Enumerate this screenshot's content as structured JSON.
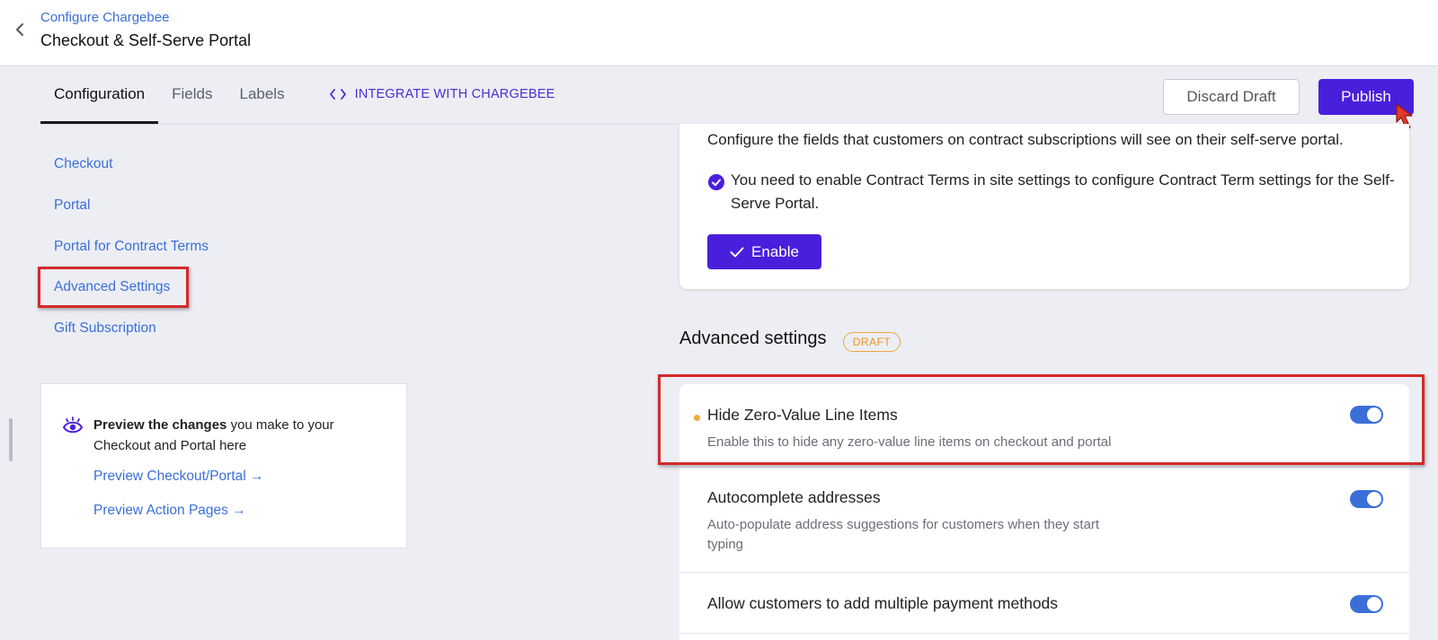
{
  "header": {
    "breadcrumb": "Configure Chargebee",
    "title": "Checkout & Self-Serve Portal"
  },
  "tabs": [
    {
      "label": "Configuration",
      "active": true
    },
    {
      "label": "Fields",
      "active": false
    },
    {
      "label": "Labels",
      "active": false
    },
    {
      "label": "INTEGRATE WITH CHARGEBEE",
      "icon": "code-icon"
    }
  ],
  "actions": {
    "discard_label": "Discard Draft",
    "publish_label": "Publish"
  },
  "sidenav": {
    "items": [
      {
        "label": "Checkout"
      },
      {
        "label": "Portal"
      },
      {
        "label": "Portal for Contract Terms"
      },
      {
        "label": "Advanced Settings",
        "highlighted": true
      },
      {
        "label": "Gift Subscription"
      }
    ]
  },
  "preview": {
    "bold_text": "Preview the changes",
    "text": " you make to your Checkout and Portal here",
    "link_checkout": "Preview Checkout/Portal →",
    "link_action": "Preview Action Pages →"
  },
  "contract": {
    "description": "Configure the fields that customers on contract subscriptions will see on their self-serve portal.",
    "note": "You need to enable Contract Terms in site settings to configure Contract Term settings for the Self-Serve Portal.",
    "enable_label": "Enable"
  },
  "advanced": {
    "title": "Advanced settings",
    "badge": "DRAFT",
    "settings": [
      {
        "title": "Hide Zero-Value Line Items",
        "description": "Enable this to hide any zero-value line items on checkout and portal",
        "enabled": true,
        "modified": true
      },
      {
        "title": "Autocomplete addresses",
        "description": "Auto-populate address suggestions for customers when they start typing",
        "enabled": true,
        "modified": false
      },
      {
        "title": "Allow customers to add multiple payment methods",
        "description": "",
        "enabled": true,
        "modified": false
      }
    ]
  },
  "colors": {
    "accent": "#4a1fdc",
    "link": "#3b6fd8",
    "highlight": "#d32a2a",
    "draft": "#e8952a"
  }
}
